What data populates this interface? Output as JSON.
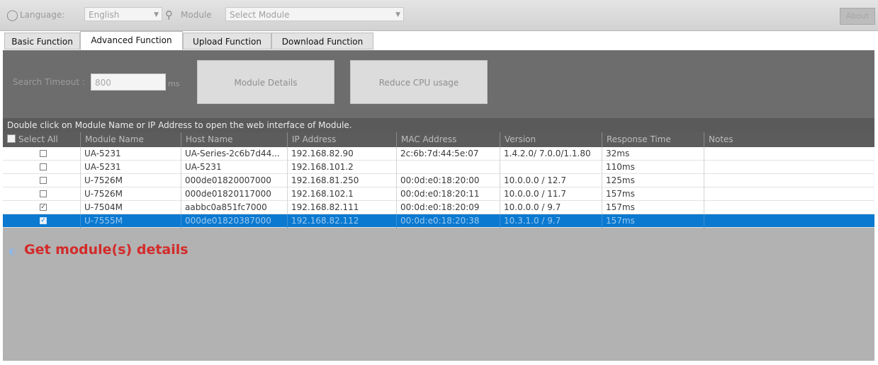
{
  "toolbar": {
    "language_label": "Language:",
    "language_value": "English",
    "module_label": "Module",
    "module_placeholder": "Select Module",
    "about_label": "About"
  },
  "tabs": [
    {
      "label": "Basic Function",
      "active": false
    },
    {
      "label": "Advanced Function",
      "active": true
    },
    {
      "label": "Upload Function",
      "active": false
    },
    {
      "label": "Download Function",
      "active": false
    }
  ],
  "panel": {
    "timeout_label": "Search Timeout :",
    "timeout_value": "800",
    "timeout_unit": "ms",
    "module_details_button": "Module Details",
    "reduce_cpu_button": "Reduce CPU usage"
  },
  "hint": "Double click on Module Name or IP Address to open the web interface of Module.",
  "grid": {
    "columns": [
      "Select All",
      "Module Name",
      "Host Name",
      "IP Address",
      "MAC Address",
      "Version",
      "Response Time",
      "Notes"
    ],
    "rows": [
      {
        "checked": false,
        "selected": false,
        "module": "UA-5231",
        "host": "UA-Series-2c6b7d44...",
        "ip": "192.168.82.90",
        "mac": "2c:6b:7d:44:5e:07",
        "version": "1.4.2.0/ 7.0.0/1.1.80",
        "response": "32ms",
        "notes": ""
      },
      {
        "checked": false,
        "selected": false,
        "module": "UA-5231",
        "host": "UA-5231",
        "ip": "192.168.101.2",
        "mac": "",
        "version": "",
        "response": "110ms",
        "notes": ""
      },
      {
        "checked": false,
        "selected": false,
        "module": "U-7526M",
        "host": "000de01820007000",
        "ip": "192.168.81.250",
        "mac": "00:0d:e0:18:20:00",
        "version": "10.0.0.0 / 12.7",
        "response": "125ms",
        "notes": ""
      },
      {
        "checked": false,
        "selected": false,
        "module": "U-7526M",
        "host": "000de01820117000",
        "ip": "192.168.102.1",
        "mac": "00:0d:e0:18:20:11",
        "version": "10.0.0.0 / 11.7",
        "response": "157ms",
        "notes": ""
      },
      {
        "checked": true,
        "selected": false,
        "module": "U-7504M",
        "host": "aabbc0a851fc7000",
        "ip": "192.168.82.111",
        "mac": "00:0d:e0:18:20:09",
        "version": "10.0.0.0 / 9.7",
        "response": "157ms",
        "notes": ""
      },
      {
        "checked": true,
        "selected": true,
        "module": "U-7555M",
        "host": "000de01820387000",
        "ip": "192.168.82.112",
        "mac": "00:0d:e0:18:20:38",
        "version": "10.3.1.0 / 9.7",
        "response": "157ms",
        "notes": ""
      }
    ]
  },
  "status": {
    "text": "Get module(s) details",
    "icon": "loading-icon",
    "color": "#d42a2a"
  },
  "colors": {
    "selection": "#0b79d0",
    "panel": "#6d6d6d",
    "grid_background": "#b2b2b2"
  }
}
